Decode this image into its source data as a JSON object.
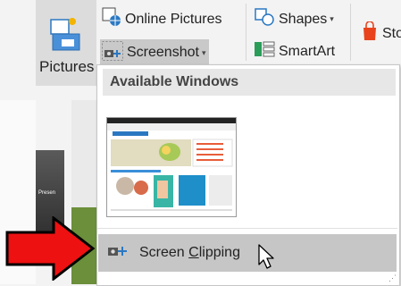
{
  "ribbon": {
    "pictures_label": "Pictures",
    "online_pictures_label": "Online Pictures",
    "screenshot_label": "Screenshot",
    "shapes_label": "Shapes",
    "smartart_label": "SmartArt",
    "store_label": "Sto",
    "dropdown_glyph": "▾"
  },
  "menu": {
    "header": "Available Windows",
    "thumbnail_caption": "Presen",
    "screen_clipping_prefix": "Screen ",
    "screen_clipping_underlined": "C",
    "screen_clipping_suffix": "lipping"
  },
  "colors": {
    "ribbon_bg": "#f3f3f3",
    "hover_bg": "#c6c6c6",
    "arrow_red": "#ee1111",
    "accent_blue": "#2b78c2"
  }
}
